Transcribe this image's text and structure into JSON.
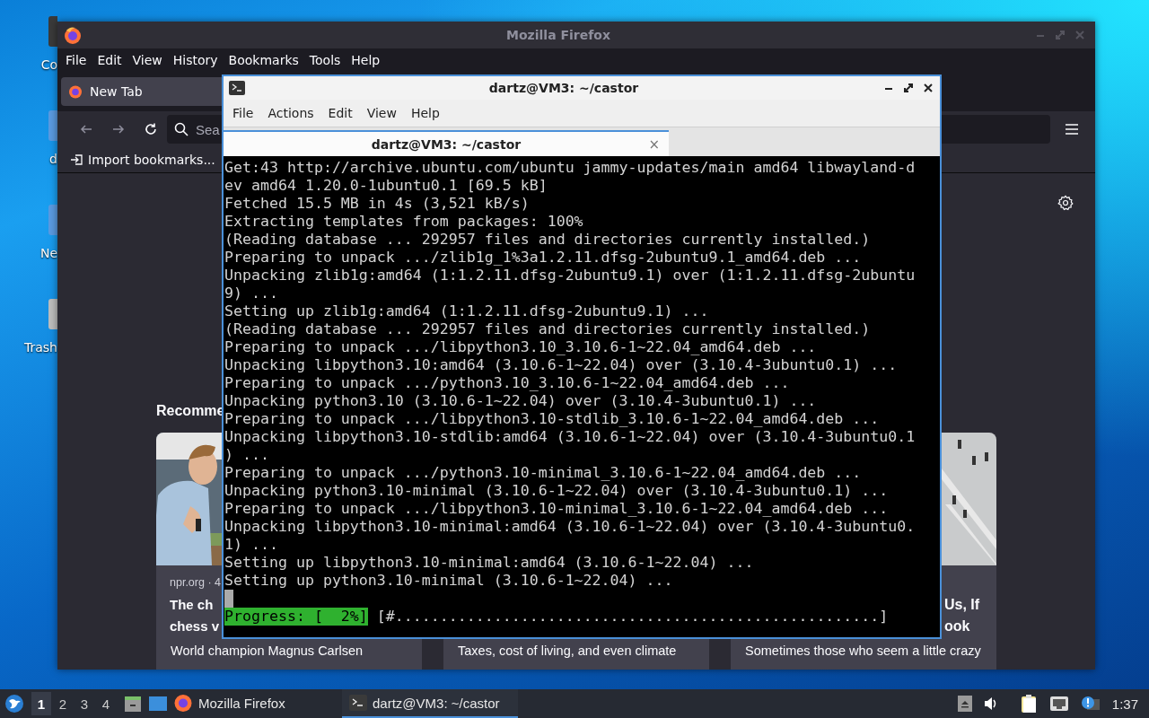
{
  "desktop_icons": [
    {
      "label": "Co"
    },
    {
      "label": "d"
    },
    {
      "label": "Ne"
    },
    {
      "label": "Trash"
    }
  ],
  "firefox": {
    "title": "Mozilla Firefox",
    "menu": [
      "File",
      "Edit",
      "View",
      "History",
      "Bookmarks",
      "Tools",
      "Help"
    ],
    "tabs": [
      {
        "label": "New Tab",
        "selected": true
      }
    ],
    "search": {
      "placeholder": "Sea"
    },
    "bookmarks": [
      "Import bookmarks..."
    ],
    "section_title": "Recomme",
    "cards": [
      {
        "source": "npr.org · 4",
        "title_lines": [
          "The ch",
          "chess v"
        ],
        "description_lines": [
          "World champion Magnus Carlsen"
        ]
      },
      {
        "description_lines": [
          "Taxes, cost of living, and even climate"
        ]
      },
      {
        "title_lines": [
          "Us, If",
          "ook"
        ],
        "description_lines": [
          "Sometimes those who seem a little crazy"
        ]
      }
    ]
  },
  "terminal": {
    "title": "dartz@VM3: ~/castor",
    "menu": [
      "File",
      "Actions",
      "Edit",
      "View",
      "Help"
    ],
    "tabs": [
      {
        "label": "dartz@VM3: ~/castor",
        "selected": true,
        "close": "×"
      }
    ],
    "lines": [
      "Get:43 http://archive.ubuntu.com/ubuntu jammy-updates/main amd64 libwayland-d",
      "ev amd64 1.20.0-1ubuntu0.1 [69.5 kB]",
      "Fetched 15.5 MB in 4s (3,521 kB/s)",
      "Extracting templates from packages: 100%",
      "(Reading database ... 292957 files and directories currently installed.)",
      "Preparing to unpack .../zlib1g_1%3a1.2.11.dfsg-2ubuntu9.1_amd64.deb ...",
      "Unpacking zlib1g:amd64 (1:1.2.11.dfsg-2ubuntu9.1) over (1:1.2.11.dfsg-2ubuntu",
      "9) ...",
      "Setting up zlib1g:amd64 (1:1.2.11.dfsg-2ubuntu9.1) ...",
      "(Reading database ... 292957 files and directories currently installed.)",
      "Preparing to unpack .../libpython3.10_3.10.6-1~22.04_amd64.deb ...",
      "Unpacking libpython3.10:amd64 (3.10.6-1~22.04) over (3.10.4-3ubuntu0.1) ...",
      "Preparing to unpack .../python3.10_3.10.6-1~22.04_amd64.deb ...",
      "Unpacking python3.10 (3.10.6-1~22.04) over (3.10.4-3ubuntu0.1) ...",
      "Preparing to unpack .../libpython3.10-stdlib_3.10.6-1~22.04_amd64.deb ...",
      "Unpacking libpython3.10-stdlib:amd64 (3.10.6-1~22.04) over (3.10.4-3ubuntu0.1",
      ") ...",
      "Preparing to unpack .../python3.10-minimal_3.10.6-1~22.04_amd64.deb ...",
      "Unpacking python3.10-minimal (3.10.6-1~22.04) over (3.10.4-3ubuntu0.1) ...",
      "Preparing to unpack .../libpython3.10-minimal_3.10.6-1~22.04_amd64.deb ...",
      "Unpacking libpython3.10-minimal:amd64 (3.10.6-1~22.04) over (3.10.4-3ubuntu0.",
      "1) ...",
      "Setting up libpython3.10-minimal:amd64 (3.10.6-1~22.04) ...",
      "Setting up python3.10-minimal (3.10.6-1~22.04) ..."
    ],
    "progress": {
      "label": "Progress: [  2%]",
      "bar": "[#......................................................]"
    }
  },
  "taskbar": {
    "workspaces": [
      {
        "label": "1",
        "selected": true
      },
      {
        "label": "2",
        "selected": false
      },
      {
        "label": "3",
        "selected": false
      },
      {
        "label": "4",
        "selected": false
      }
    ],
    "tasks": [
      {
        "kind": "browser",
        "label": "Mozilla Firefox",
        "selected": false
      },
      {
        "kind": "terminal",
        "label": "dartz@VM3: ~/castor",
        "selected": true
      }
    ],
    "clock": "1:37"
  }
}
